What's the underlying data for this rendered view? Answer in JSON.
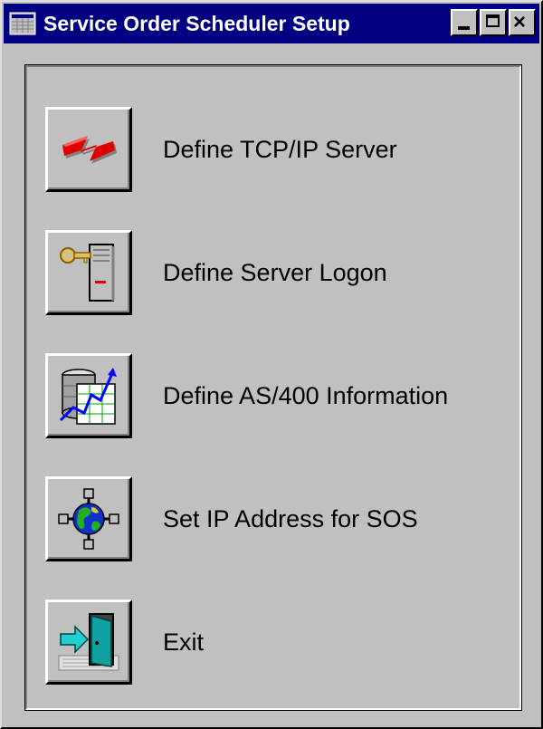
{
  "window": {
    "title": "Service Order Scheduler Setup",
    "minimize_glyph": "minimize-icon",
    "maximize_glyph": "maximize-icon",
    "close_glyph": "×"
  },
  "menu": {
    "items": [
      {
        "label": "Define TCP/IP Server",
        "icon": "tcpip-server-icon"
      },
      {
        "label": "Define Server Logon",
        "icon": "key-server-icon"
      },
      {
        "label": "Define AS/400 Information",
        "icon": "database-chart-icon"
      },
      {
        "label": "Set IP Address for SOS",
        "icon": "globe-network-icon"
      },
      {
        "label": "Exit",
        "icon": "exit-door-icon"
      }
    ]
  },
  "colors": {
    "titlebar": "#000080",
    "face": "#c0c0c0"
  }
}
